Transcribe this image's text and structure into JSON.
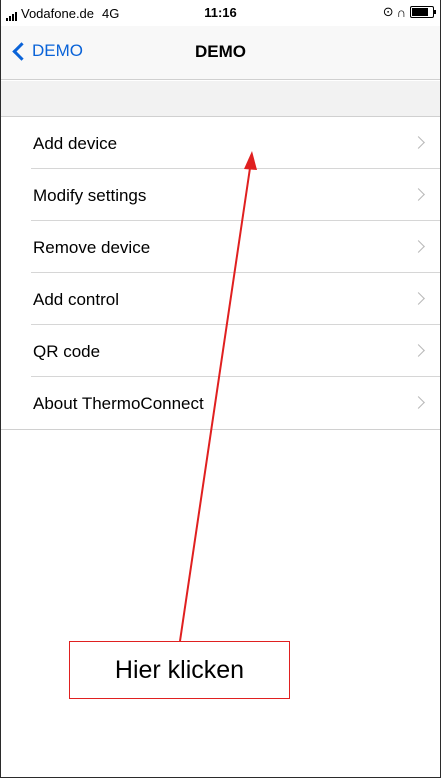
{
  "status_bar": {
    "carrier": "Vodafone.de",
    "network": "4G",
    "time": "11:16",
    "icons": [
      "lock-rotation-icon",
      "headphones-icon",
      "battery-icon"
    ],
    "battery_level": 0.8
  },
  "nav": {
    "back_label": "DEMO",
    "title": "DEMO"
  },
  "menu": {
    "items": [
      {
        "label": "Add device"
      },
      {
        "label": "Modify settings"
      },
      {
        "label": "Remove device"
      },
      {
        "label": "Add control"
      },
      {
        "label": "QR code"
      },
      {
        "label": "About ThermoConnect"
      }
    ]
  },
  "annotation": {
    "callout_text": "Hier klicken",
    "color": "#e02020"
  },
  "colors": {
    "accent": "#0a63d8",
    "separator": "#d6d6d6",
    "chevron": "#b8b8b8"
  }
}
